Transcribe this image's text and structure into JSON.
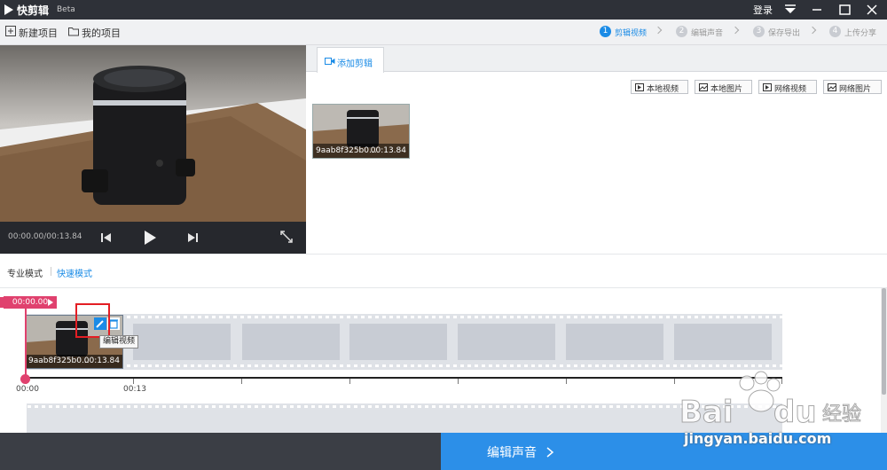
{
  "titlebar": {
    "app_title": "快剪辑",
    "app_badge": "Beta",
    "login_label": "登录"
  },
  "toolbar": {
    "new_project_label": "新建项目",
    "my_projects_label": "我的项目",
    "steps": [
      {
        "num": "1",
        "label": "剪辑视频",
        "active": true
      },
      {
        "num": "2",
        "label": "编辑声音",
        "active": false
      },
      {
        "num": "3",
        "label": "保存导出",
        "active": false
      },
      {
        "num": "4",
        "label": "上传分享",
        "active": false
      }
    ]
  },
  "preview": {
    "time_readout": "00:00.00/00:13.84"
  },
  "media_panel": {
    "tab_label": "添加剪辑",
    "source_buttons": [
      "本地视频",
      "本地图片",
      "网络视频",
      "网络图片"
    ],
    "items": [
      {
        "name": "9aab8f325b0...",
        "duration": "00:13.84"
      }
    ]
  },
  "modes": {
    "pro_label": "专业模式",
    "quick_label": "快速模式"
  },
  "timeline": {
    "current_time": "00:00.00",
    "clip": {
      "name": "9aab8f325b0...",
      "duration": "00:13.84"
    },
    "tooltip": "编辑视频",
    "ruler_labels": [
      "00:00",
      "00:13"
    ]
  },
  "bottom": {
    "next_label": "编辑声音"
  },
  "watermark": {
    "url": "jingyan.baidu.com"
  },
  "colors": {
    "accent": "#1a8be6",
    "titlebar": "#2e3138",
    "playhead": "#e0416e",
    "highlight": "#e31e24"
  }
}
